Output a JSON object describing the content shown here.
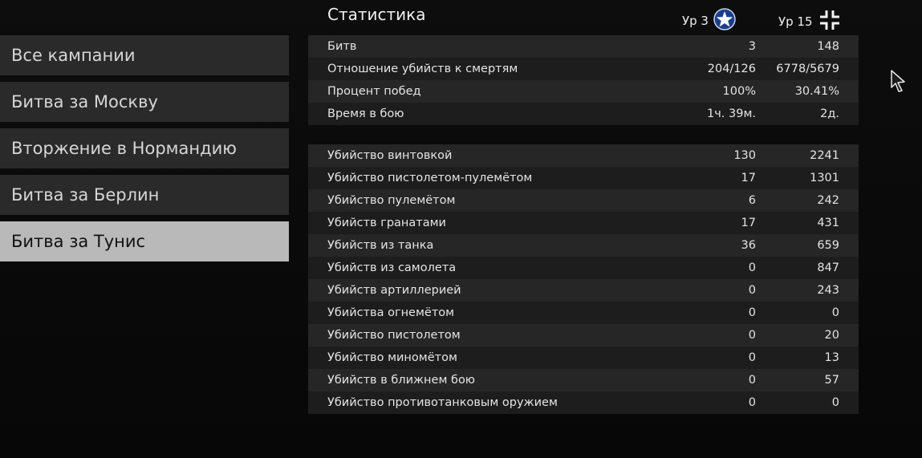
{
  "sidebar": {
    "items": [
      {
        "label": "Все кампании"
      },
      {
        "label": "Битва за Москву"
      },
      {
        "label": "Вторжение в Нормандию"
      },
      {
        "label": "Битва за Берлин"
      },
      {
        "label": "Битва за Тунис",
        "active": true
      }
    ]
  },
  "header": {
    "title": "Статистика",
    "level1": "Ур 3",
    "level1_icon": "us-star-icon",
    "level2": "Ур 15",
    "level2_icon": "german-cross-icon"
  },
  "summary": [
    {
      "label": "Битв",
      "v1": "3",
      "v2": "148"
    },
    {
      "label": "Отношение убийств к смертям",
      "v1": "204/126",
      "v2": "6778/5679"
    },
    {
      "label": "Процент побед",
      "v1": "100%",
      "v2": "30.41%"
    },
    {
      "label": "Время в бою",
      "v1": "1ч. 39м.",
      "v2": "2д."
    }
  ],
  "kills": [
    {
      "label": "Убийство винтовкой",
      "v1": "130",
      "v2": "2241"
    },
    {
      "label": "Убийство пистолетом-пулемётом",
      "v1": "17",
      "v2": "1301"
    },
    {
      "label": "Убийство пулемётом",
      "v1": "6",
      "v2": "242"
    },
    {
      "label": "Убийств гранатами",
      "v1": "17",
      "v2": "431"
    },
    {
      "label": "Убийств из танка",
      "v1": "36",
      "v2": "659"
    },
    {
      "label": "Убийств из самолета",
      "v1": "0",
      "v2": "847"
    },
    {
      "label": "Убийств артиллерией",
      "v1": "0",
      "v2": "243"
    },
    {
      "label": "Убийства огнемётом",
      "v1": "0",
      "v2": "0"
    },
    {
      "label": "Убийство пистолетом",
      "v1": "0",
      "v2": "20"
    },
    {
      "label": "Убийство миномётом",
      "v1": "0",
      "v2": "13"
    },
    {
      "label": "Убийств в ближнем бою",
      "v1": "0",
      "v2": "57"
    },
    {
      "label": "Убийство противотанковым оружием",
      "v1": "0",
      "v2": "0"
    }
  ]
}
